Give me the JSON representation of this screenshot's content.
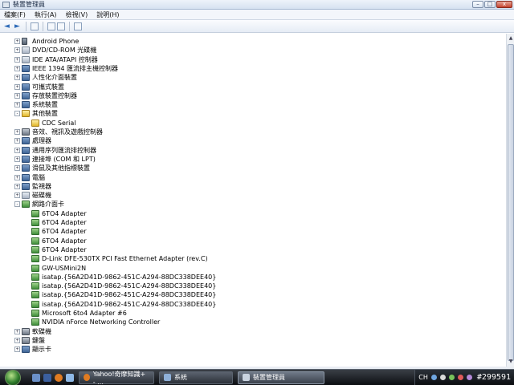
{
  "window": {
    "title": "裝置管理員"
  },
  "menu": [
    "檔案(F)",
    "執行(A)",
    "檢視(V)",
    "說明(H)"
  ],
  "window_controls": {
    "minimize": "–",
    "maximize": "□",
    "close": "x"
  },
  "toolbar": {
    "back": "◄",
    "forward": "►"
  },
  "tree": [
    {
      "label": "Android Phone",
      "level": 0,
      "expander": "+",
      "icon": "phone-icon"
    },
    {
      "label": "DVD/CD-ROM 光碟機",
      "level": 0,
      "expander": "+",
      "icon": "disc-drive-icon"
    },
    {
      "label": "IDE ATA/ATAPI 控制器",
      "level": 0,
      "expander": "+",
      "icon": "ide-controller-icon"
    },
    {
      "label": "IEEE 1394 匯流排主機控制器",
      "level": 0,
      "expander": "+",
      "icon": "firewire-icon"
    },
    {
      "label": "人性化介面裝置",
      "level": 0,
      "expander": "+",
      "icon": "hid-icon"
    },
    {
      "label": "可攜式裝置",
      "level": 0,
      "expander": "+",
      "icon": "portable-device-icon"
    },
    {
      "label": "存放裝置控制器",
      "level": 0,
      "expander": "+",
      "icon": "storage-controller-icon"
    },
    {
      "label": "系統裝置",
      "level": 0,
      "expander": "+",
      "icon": "system-device-icon"
    },
    {
      "label": "其他裝置",
      "level": 0,
      "expander": "-",
      "icon": "other-device-icon"
    },
    {
      "label": "CDC Serial",
      "level": 1,
      "expander": "",
      "icon": "warning-device-icon"
    },
    {
      "label": "音效、視訊及遊戲控制器",
      "level": 0,
      "expander": "+",
      "icon": "sound-icon"
    },
    {
      "label": "處理器",
      "level": 0,
      "expander": "+",
      "icon": "processor-icon"
    },
    {
      "label": "通用序列匯流排控制器",
      "level": 0,
      "expander": "+",
      "icon": "usb-icon"
    },
    {
      "label": "連接埠 (COM 和 LPT)",
      "level": 0,
      "expander": "+",
      "icon": "port-icon"
    },
    {
      "label": "滑鼠及其他指標裝置",
      "level": 0,
      "expander": "+",
      "icon": "mouse-icon"
    },
    {
      "label": "電腦",
      "level": 0,
      "expander": "+",
      "icon": "computer-icon"
    },
    {
      "label": "監視器",
      "level": 0,
      "expander": "+",
      "icon": "monitor-icon"
    },
    {
      "label": "磁碟機",
      "level": 0,
      "expander": "+",
      "icon": "disk-drive-icon"
    },
    {
      "label": "網路介面卡",
      "level": 0,
      "expander": "-",
      "icon": "network-adapter-icon"
    },
    {
      "label": "6TO4 Adapter",
      "level": 1,
      "expander": "",
      "icon": "network-adapter-icon"
    },
    {
      "label": "6TO4 Adapter",
      "level": 1,
      "expander": "",
      "icon": "network-adapter-icon"
    },
    {
      "label": "6TO4 Adapter",
      "level": 1,
      "expander": "",
      "icon": "network-adapter-icon"
    },
    {
      "label": "6TO4 Adapter",
      "level": 1,
      "expander": "",
      "icon": "network-adapter-icon"
    },
    {
      "label": "6TO4 Adapter",
      "level": 1,
      "expander": "",
      "icon": "network-adapter-icon"
    },
    {
      "label": "D-Link DFE-530TX PCI Fast Ethernet Adapter (rev.C)",
      "level": 1,
      "expander": "",
      "icon": "network-adapter-icon"
    },
    {
      "label": "GW-USMini2N",
      "level": 1,
      "expander": "",
      "icon": "network-adapter-icon"
    },
    {
      "label": "isatap.{56A2D41D-9862-451C-A294-88DC338DEE40}",
      "level": 1,
      "expander": "",
      "icon": "network-adapter-icon"
    },
    {
      "label": "isatap.{56A2D41D-9862-451C-A294-88DC338DEE40}",
      "level": 1,
      "expander": "",
      "icon": "network-adapter-icon"
    },
    {
      "label": "isatap.{56A2D41D-9862-451C-A294-88DC338DEE40}",
      "level": 1,
      "expander": "",
      "icon": "network-adapter-icon"
    },
    {
      "label": "isatap.{56A2D41D-9862-451C-A294-88DC338DEE40}",
      "level": 1,
      "expander": "",
      "icon": "network-adapter-icon"
    },
    {
      "label": "Microsoft 6to4 Adapter #6",
      "level": 1,
      "expander": "",
      "icon": "network-adapter-icon"
    },
    {
      "label": "NVIDIA nForce Networking Controller",
      "level": 1,
      "expander": "",
      "icon": "network-adapter-icon"
    },
    {
      "label": "軟碟機",
      "level": 0,
      "expander": "+",
      "icon": "floppy-icon"
    },
    {
      "label": "鍵盤",
      "level": 0,
      "expander": "+",
      "icon": "keyboard-icon"
    },
    {
      "label": "顯示卡",
      "level": 0,
      "expander": "+",
      "icon": "display-adapter-icon"
    }
  ],
  "taskbar": {
    "tasks": [
      {
        "label": "Yahoo!奇摩知識+ - ..."
      },
      {
        "label": "系統"
      },
      {
        "label": "裝置管理員"
      }
    ],
    "tray_lang": "CH",
    "clock": "#299591"
  }
}
